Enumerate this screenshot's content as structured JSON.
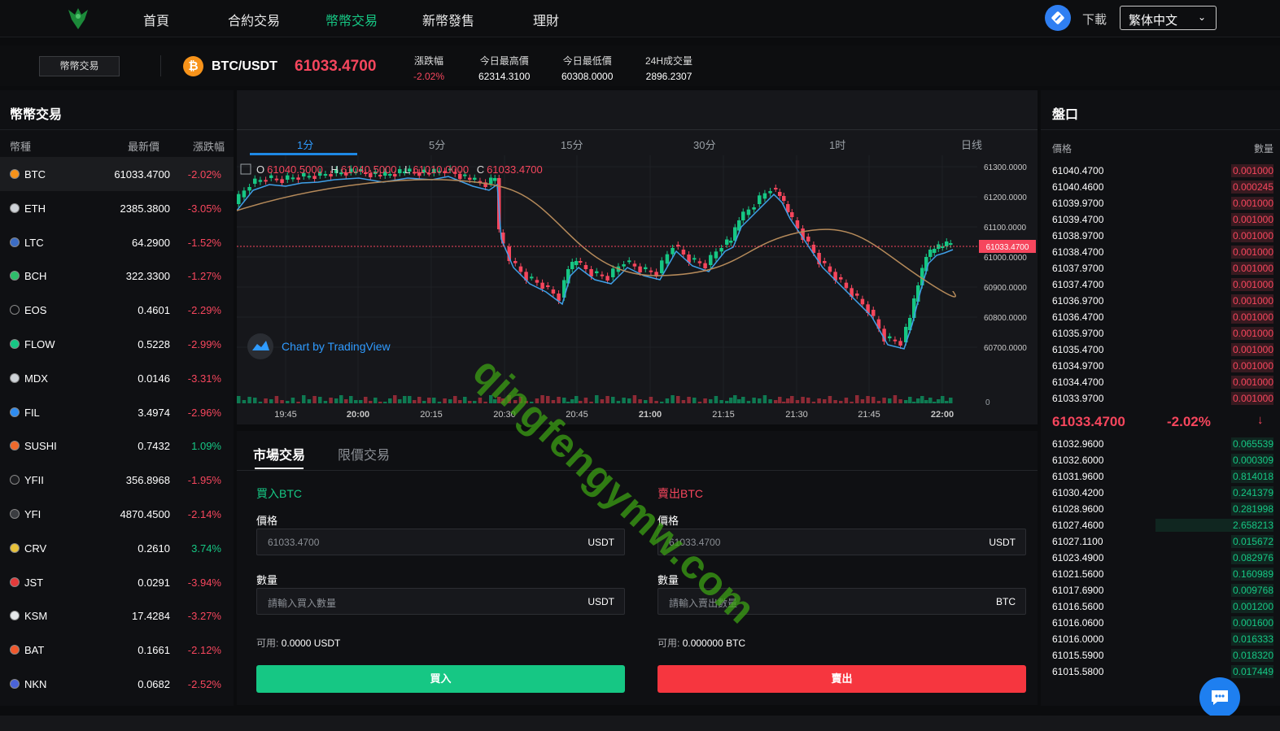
{
  "nav": {
    "items": [
      "首頁",
      "合約交易",
      "幣幣交易",
      "新幣發售",
      "理財"
    ],
    "active_index": 2,
    "download_label": "下載",
    "language": "繁体中文"
  },
  "ticker": {
    "tab_label": "幣幣交易",
    "coin_symbol": "₿",
    "pair": "BTC/USDT",
    "price": "61033.4700",
    "stats": [
      {
        "label": "漲跌幅",
        "value": "-2.02%"
      },
      {
        "label": "今日最高價",
        "value": "62314.3100"
      },
      {
        "label": "今日最低價",
        "value": "60308.0000"
      },
      {
        "label": "24H成交量",
        "value": "2896.2307"
      }
    ]
  },
  "market": {
    "title": "幣幣交易",
    "headers": {
      "coin": "幣種",
      "price": "最新價",
      "change": "漲跌幅"
    },
    "rows": [
      {
        "sym": "BTC",
        "price": "61033.4700",
        "chg": "-2.02%",
        "color": "#f7931a"
      },
      {
        "sym": "ETH",
        "price": "2385.3800",
        "chg": "-3.05%",
        "color": "#cfd3d8"
      },
      {
        "sym": "LTC",
        "price": "64.2900",
        "chg": "-1.52%",
        "color": "#3c6dc5"
      },
      {
        "sym": "BCH",
        "price": "322.3300",
        "chg": "-1.27%",
        "color": "#2ebd6b"
      },
      {
        "sym": "EOS",
        "price": "0.4601",
        "chg": "-2.29%",
        "color": "#0f1013"
      },
      {
        "sym": "FLOW",
        "price": "0.5228",
        "chg": "-2.99%",
        "color": "#16c784"
      },
      {
        "sym": "MDX",
        "price": "0.0146",
        "chg": "-3.31%",
        "color": "#cfd3d8"
      },
      {
        "sym": "FIL",
        "price": "3.4974",
        "chg": "-2.96%",
        "color": "#2f8cf0"
      },
      {
        "sym": "SUSHI",
        "price": "0.7432",
        "chg": "1.09%",
        "color": "#f06a2c"
      },
      {
        "sym": "YFII",
        "price": "356.8968",
        "chg": "-1.95%",
        "color": "#1b1c1f"
      },
      {
        "sym": "YFI",
        "price": "4870.4500",
        "chg": "-2.14%",
        "color": "#3a3c40"
      },
      {
        "sym": "CRV",
        "price": "0.2610",
        "chg": "3.74%",
        "color": "#e8c23a"
      },
      {
        "sym": "JST",
        "price": "0.0291",
        "chg": "-3.94%",
        "color": "#e33b3b"
      },
      {
        "sym": "KSM",
        "price": "17.4284",
        "chg": "-3.27%",
        "color": "#e6e8ea"
      },
      {
        "sym": "BAT",
        "price": "0.1661",
        "chg": "-2.12%",
        "color": "#f0582c"
      },
      {
        "sym": "NKN",
        "price": "0.0682",
        "chg": "-2.52%",
        "color": "#4a63d8"
      }
    ]
  },
  "chart": {
    "timeframes": [
      "1分",
      "5分",
      "15分",
      "30分",
      "1时",
      "日线"
    ],
    "active_tf": 0,
    "ohlc": {
      "o_label": "O",
      "o": "61040.5000",
      "h_label": "H",
      "h": "61040.5000",
      "l_label": "L",
      "l": "61010.0000",
      "c_label": "C",
      "c": "61033.4700"
    },
    "y_ticks": [
      "61300.0000",
      "61200.0000",
      "61100.0000",
      "61000.0000",
      "60900.0000",
      "60800.0000",
      "60700.0000"
    ],
    "last_price_tag": "61033.4700",
    "volume_zero": "0",
    "x_ticks": [
      "19:45",
      "20:00",
      "20:15",
      "20:30",
      "20:45",
      "21:00",
      "21:15",
      "21:30",
      "21:45",
      "22:00"
    ],
    "attribution": "Chart by TradingView"
  },
  "trade": {
    "tabs": [
      "市場交易",
      "限價交易"
    ],
    "buy": {
      "title": "買入BTC",
      "price_label": "價格",
      "price_value": "61033.4700",
      "price_unit": "USDT",
      "qty_label": "數量",
      "qty_placeholder": "請輸入買入數量",
      "qty_unit": "USDT",
      "avail_label": "可用:",
      "avail_value": "0.0000 USDT",
      "button": "買入"
    },
    "sell": {
      "title": "賣出BTC",
      "price_label": "價格",
      "price_value": "61033.4700",
      "price_unit": "USDT",
      "qty_label": "數量",
      "qty_placeholder": "請輸入賣出數量",
      "qty_unit": "BTC",
      "avail_label": "可用:",
      "avail_value": "0.000000 BTC",
      "button": "賣出"
    }
  },
  "book": {
    "title": "盤口",
    "headers": {
      "price": "價格",
      "qty": "數量"
    },
    "asks": [
      [
        "61040.4700",
        "0.001000"
      ],
      [
        "61040.4600",
        "0.000245"
      ],
      [
        "61039.9700",
        "0.001000"
      ],
      [
        "61039.4700",
        "0.001000"
      ],
      [
        "61038.9700",
        "0.001000"
      ],
      [
        "61038.4700",
        "0.001000"
      ],
      [
        "61037.9700",
        "0.001000"
      ],
      [
        "61037.4700",
        "0.001000"
      ],
      [
        "61036.9700",
        "0.001000"
      ],
      [
        "61036.4700",
        "0.001000"
      ],
      [
        "61035.9700",
        "0.001000"
      ],
      [
        "61035.4700",
        "0.001000"
      ],
      [
        "61034.9700",
        "0.001000"
      ],
      [
        "61034.4700",
        "0.001000"
      ],
      [
        "61033.9700",
        "0.001000"
      ]
    ],
    "mid_price": "61033.4700",
    "mid_change": "-2.02%",
    "mid_arrow": "↓",
    "bids": [
      [
        "61032.9600",
        "0.065539"
      ],
      [
        "61032.6000",
        "0.000309"
      ],
      [
        "61031.9600",
        "0.814018"
      ],
      [
        "61030.4200",
        "0.241379"
      ],
      [
        "61028.9600",
        "0.281998"
      ],
      [
        "61027.4600",
        "2.658213"
      ],
      [
        "61027.1100",
        "0.015672"
      ],
      [
        "61023.4900",
        "0.082976"
      ],
      [
        "61021.5600",
        "0.160989"
      ],
      [
        "61017.6900",
        "0.009768"
      ],
      [
        "61016.5600",
        "0.001200"
      ],
      [
        "61016.0600",
        "0.001600"
      ],
      [
        "61016.0000",
        "0.016333"
      ],
      [
        "61015.5900",
        "0.018320"
      ],
      [
        "61015.5800",
        "0.017449"
      ]
    ]
  },
  "watermark": "qingfengymw.com",
  "colors": {
    "up": "#16c784",
    "down": "#f6465d",
    "accent": "#2f9bff"
  }
}
